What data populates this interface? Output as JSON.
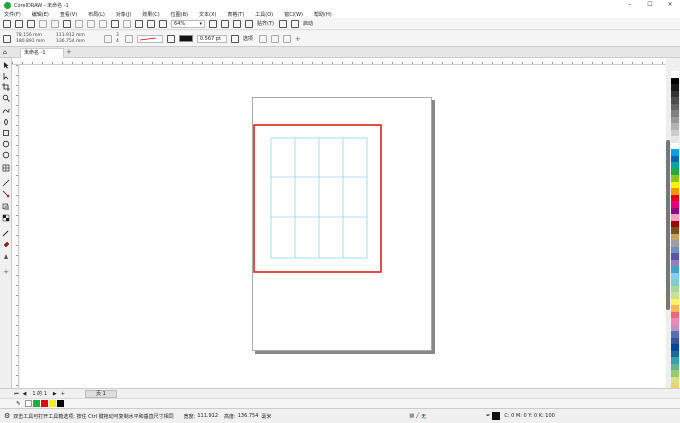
{
  "window": {
    "title": "CorelDRAW - 未命名 -1"
  },
  "menu": [
    "文件(F)",
    "编辑(E)",
    "查看(V)",
    "布局(L)",
    "对象(J)",
    "效果(C)",
    "位图(B)",
    "文本(X)",
    "表格(T)",
    "工具(O)",
    "窗口(W)",
    "帮助(H)"
  ],
  "toolbar1": {
    "zoom": "64%",
    "snap_label": "贴齐(T)",
    "launch_label": "启动"
  },
  "toolbar2": {
    "x": "78.156 mm",
    "y": "180.891 mm",
    "w": "111.912 mm",
    "h": "136.754 mm",
    "cols": "3",
    "rows": "4",
    "outline_width": "0.567 pt",
    "options_label": "选项"
  },
  "tab": {
    "name": "未命名 -1"
  },
  "pagebar": {
    "counter": "1 的 1",
    "page_tab": "页 1"
  },
  "status": {
    "hint": "双击工具可打开工具箱选项; 按住 Ctrl 键拖动可复制水平和垂直尺寸相同",
    "width_label": "宽度:",
    "width_value": "111.912",
    "height_label": "高度:",
    "height_value": "136.754",
    "unit": "毫米",
    "fill_none": "无",
    "cmyk": "C: 0 M: 0 Y: 0 K: 100"
  },
  "palette_colors": [
    "#ffffff",
    "#000000",
    "#1a1a1a",
    "#333333",
    "#4d4d4d",
    "#666666",
    "#808080",
    "#999999",
    "#b3b3b3",
    "#cccccc",
    "#e6e6e6",
    "#ffffff",
    "#00a0e9",
    "#0068b7",
    "#00a99d",
    "#22ac38",
    "#8fc31f",
    "#fff100",
    "#f39800",
    "#e60012",
    "#e4007f",
    "#920783",
    "#f19ec2",
    "#a40000",
    "#7f4f21",
    "#c8a063",
    "#a0a0a0",
    "#6f8fbf",
    "#5f52a0",
    "#8f82bc",
    "#44a3c4",
    "#7ecef4",
    "#84ccc9",
    "#acd598",
    "#cce198",
    "#fff45c",
    "#f8b551",
    "#eb6877",
    "#ee87b4",
    "#c490bf",
    "#556fb5",
    "#36559a",
    "#00479d",
    "#1b6b9a",
    "#32a3ac",
    "#62b58f",
    "#9bca6b",
    "#d7e280",
    "#e9d46b"
  ],
  "doc_palette": [
    "#22ac38",
    "#e60012",
    "#fff100",
    "#000000"
  ]
}
